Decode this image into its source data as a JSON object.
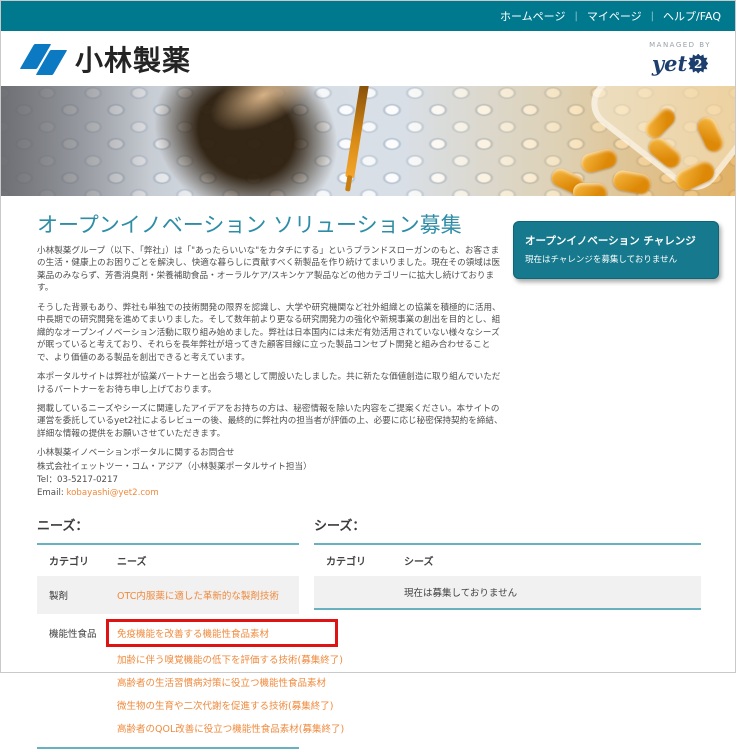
{
  "top_nav": {
    "items": [
      "ホームページ",
      "マイページ",
      "ヘルプ/FAQ"
    ]
  },
  "header": {
    "logo_text": "小林製薬",
    "managed_by_label": "MANAGED BY",
    "yet2_text": "yet",
    "yet2_num": "2"
  },
  "challenge_box": {
    "title": "オープンイノベーション チャレンジ",
    "message": "現在はチャレンジを募集しておりません"
  },
  "main": {
    "heading": "オープンイノベーション ソリューション募集",
    "paragraphs": [
      "小林製薬グループ（以下、「弊社」）は「\"あったらいいな\"をカタチにする」というブランドスローガンのもと、お客さまの生活・健康上のお困りごとを解決し、快適な暮らしに貢献すべく新製品を作り続けてまいりました。現在その領域は医薬品のみならず、芳香消臭剤・栄養補助食品・オーラルケア/スキンケア製品などの他カテゴリーに拡大し続けております。",
      "そうした背景もあり、弊社も単独での技術開発の限界を認識し、大学や研究機関など社外組織との協業を積極的に活用、中長期での研究開発を進めてまいりました。そして数年前より更なる研究開発力の強化や新規事業の創出を目的とし、組織的なオープンイノベーション活動に取り組み始めました。弊社は日本国内には未だ有効活用されていない様々なシーズが眠っていると考えており、それらを長年弊社が培ってきた顧客目線に立った製品コンセプト開発と組み合わせることで、より価値のある製品を創出できると考えています。",
      "本ポータルサイトは弊社が協業パートナーと出会う場として開設いたしました。共に新たな価値創造に取り組んでいただけるパートナーをお待ち申し上げております。",
      "掲載しているニーズやシーズに関連したアイデアをお持ちの方は、秘密情報を除いた内容をご提案ください。本サイトの運営を委託しているyet2社によるレビューの後、最終的に弊社内の担当者が評価の上、必要に応じ秘密保持契約を締結、詳細な情報の提供をお願いさせていただきます。"
    ],
    "contact": {
      "heading": "小林製薬イノベーションポータルに関するお問合せ",
      "company": "株式会社イェットツー・コム・アジア（小林製薬ポータルサイト担当）",
      "tel": "Tel：03-5217-0217",
      "email_label": "Email:",
      "email": "kobayashi@yet2.com"
    }
  },
  "needs": {
    "title": "ニーズ：",
    "columns": [
      "カテゴリ",
      "ニーズ"
    ],
    "rows": [
      {
        "category": "製剤",
        "links": [
          {
            "label": "OTC内服薬に適した革新的な製剤技術",
            "highlighted": false
          }
        ]
      },
      {
        "category": "機能性食品",
        "links": [
          {
            "label": "免疫機能を改善する機能性食品素材",
            "highlighted": true
          },
          {
            "label": "加齢に伴う嗅覚機能の低下を評価する技術(募集終了)",
            "highlighted": false
          },
          {
            "label": "高齢者の生活習慣病対策に役立つ機能性食品素材",
            "highlighted": false
          },
          {
            "label": "微生物の生育や二次代謝を促進する技術(募集終了)",
            "highlighted": false
          },
          {
            "label": "高齢者のQOL改善に役立つ機能性食品素材(募集終了)",
            "highlighted": false
          }
        ]
      }
    ]
  },
  "seeds": {
    "title": "シーズ：",
    "columns": [
      "カテゴリ",
      "シーズ"
    ],
    "empty_message": "現在は募集しておりません"
  },
  "colors": {
    "topbar_teal": "#00798f",
    "challenge_teal": "#16798d",
    "heading_teal": "#2e8da6",
    "link_orange": "#ef8a3d",
    "table_border_teal": "#68b1bf",
    "highlight_red": "#de1414",
    "logo_blue": "#0b7ac2",
    "yet2_navy": "#1c3f6e"
  }
}
